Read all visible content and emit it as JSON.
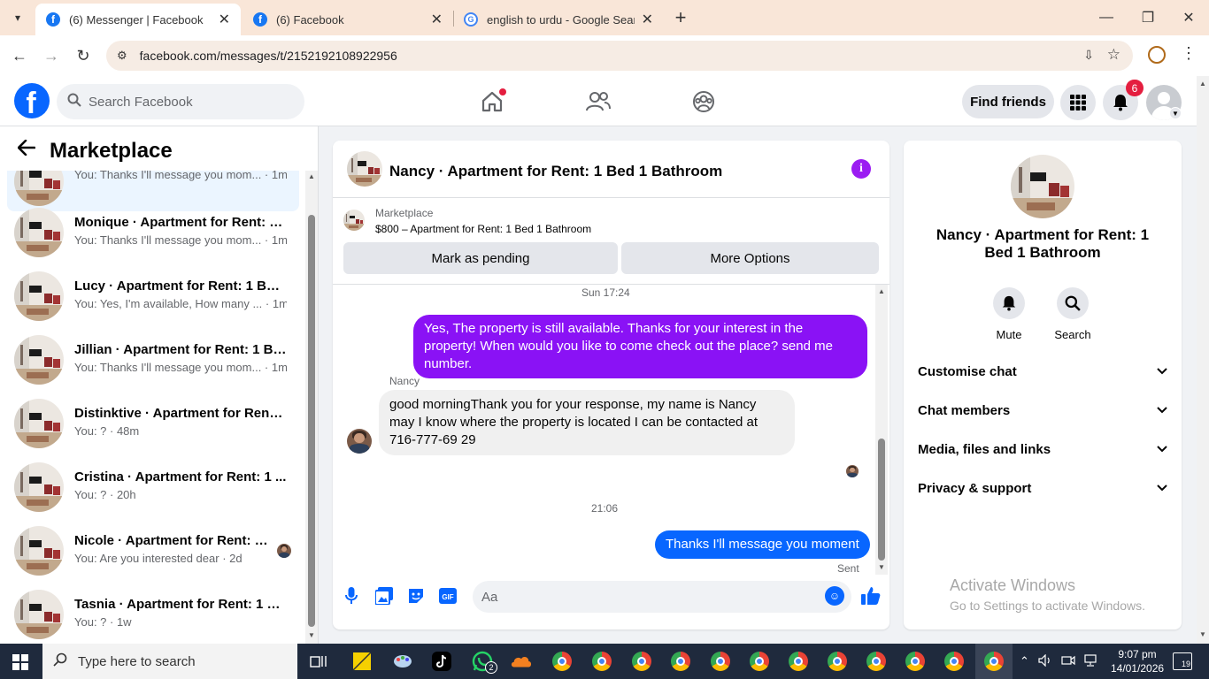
{
  "browser": {
    "tabs": [
      {
        "title": "(6) Messenger | Facebook",
        "active": true
      },
      {
        "title": "(6) Facebook",
        "active": false
      },
      {
        "title": "english to urdu - Google Search",
        "active": false
      }
    ],
    "url": "facebook.com/messages/t/2152192108922956"
  },
  "header": {
    "search_placeholder": "Search Facebook",
    "find_friends_label": "Find friends",
    "notification_count": "6"
  },
  "sidebar": {
    "title": "Marketplace",
    "conversations": [
      {
        "name": "",
        "snippet": "You: Thanks I'll message you mom... · 1m",
        "active": true
      },
      {
        "name": "Monique · Apartment for Rent: 1...",
        "snippet": "You: Thanks I'll message you mom... · 1m"
      },
      {
        "name": "Lucy · Apartment for Rent: 1 Bed...",
        "snippet": "You: Yes, I'm available, How many ... · 1m"
      },
      {
        "name": "Jillian · Apartment for Rent: 1 Be...",
        "snippet": "You: Thanks I'll message you mom... · 1m"
      },
      {
        "name": "Distinktive · Apartment for Rent:...",
        "snippet": "You: ? · 48m"
      },
      {
        "name": "Cristina · Apartment for Rent: 1 ...",
        "snippet": "You: ? · 20h"
      },
      {
        "name": "Nicole · Apartment for Rent: 1...",
        "snippet": "You: Are you interested dear · 2d"
      },
      {
        "name": "Tasnia · Apartment for Rent: 1 B...",
        "snippet": "You: ? · 1w"
      }
    ]
  },
  "chat": {
    "title": "Nancy · Apartment for Rent: 1 Bed 1 Bathroom",
    "listing": {
      "source": "Marketplace",
      "item": "$800 – Apartment for Rent: 1 Bed 1 Bathroom",
      "mark_pending_label": "Mark as pending",
      "more_options_label": "More Options"
    },
    "messages": {
      "time1": "Sun 17:24",
      "out1": "Yes, The property is still available. Thanks for your interest in the property! When would you like to come check out the place? send me number.",
      "sender": "Nancy",
      "in1": "good morningThank you for your response, my name is Nancy may I know where the property is located I can be contacted at 716-777-69 29",
      "time2": "21:06",
      "out2": "Thanks I'll message you moment",
      "status": "Sent"
    },
    "composer_placeholder": "Aa"
  },
  "details": {
    "name": "Nancy · Apartment for Rent: 1 Bed 1 Bathroom",
    "actions": {
      "mute": "Mute",
      "search": "Search"
    },
    "sections": [
      "Customise chat",
      "Chat members",
      "Media, files and links",
      "Privacy & support"
    ]
  },
  "watermark": {
    "line1": "Activate Windows",
    "line2": "Go to Settings to activate Windows."
  },
  "taskbar": {
    "search_placeholder": "Type here to search",
    "whatsapp_badge": "2",
    "time": "9:07 pm",
    "date": "14/01/2026",
    "notification_count": "19"
  },
  "colors": {
    "facebook_blue": "#0866ff",
    "outgoing_bubble": "#8a12f5",
    "badge_red": "#e41e3f"
  }
}
